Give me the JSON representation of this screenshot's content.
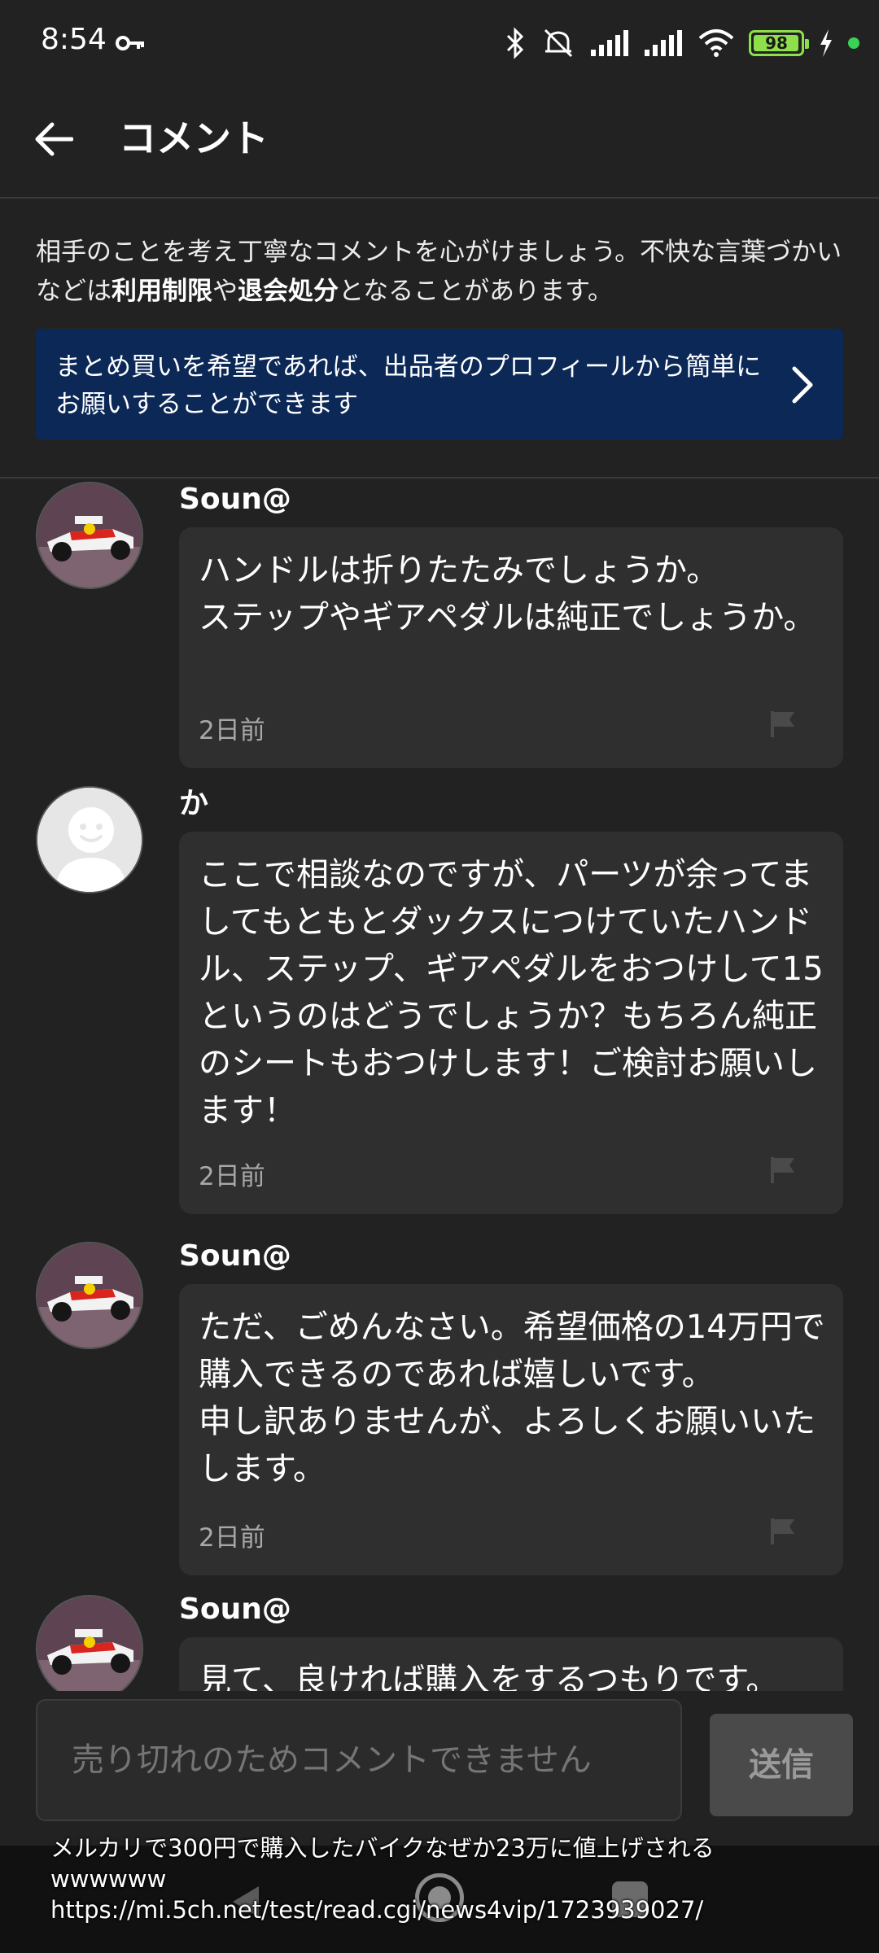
{
  "status_bar": {
    "time": "8:54",
    "battery_level": 98,
    "battery_label": "98",
    "icons": [
      "key-icon",
      "bluetooth-icon",
      "mute-icon",
      "signal-icon",
      "signal-icon",
      "wifi-icon",
      "battery-icon",
      "charging-icon",
      "green-dot"
    ]
  },
  "app_bar": {
    "title": "コメント",
    "back_icon": "arrow-left-icon"
  },
  "guideline": {
    "part1": "相手のことを考え丁寧なコメントを心がけましょう。不快な言葉づかいなどは",
    "bold1": "利用制限",
    "part2": "や",
    "bold2": "退会処分",
    "part3": "となることがあります。"
  },
  "banner": {
    "text": "まとめ買いを希望であれば、出品者のプロフィールから簡単にお願いすることができます",
    "icon": "chevron-right-icon",
    "background": "#0b2857"
  },
  "comments": [
    {
      "author": "Soun@",
      "avatar": "race-car-avatar",
      "text": "ハンドルは折りたたみでしょうか。\nステップやギアペダルは純正でしょうか。",
      "time": "2日前"
    },
    {
      "author": "か",
      "avatar": "default-avatar",
      "text": "ここで相談なのですが、パーツが余ってましてもともとダックスにつけていたハンドル、ステップ、ギアペダルをおつけして15というのはどうでしょうか？もちろん純正のシートもおつけします！ご検討お願いします！",
      "time": "2日前"
    },
    {
      "author": "Soun@",
      "avatar": "race-car-avatar",
      "text": "ただ、ごめんなさい。希望価格の14万円で購入できるのであれば嬉しいです。\n申し訳ありませんが、よろしくお願いいたします。",
      "time": "2日前"
    },
    {
      "author": "Soun@",
      "avatar": "race-car-avatar",
      "text": "見て、良ければ購入をするつもりです。",
      "time": ""
    }
  ],
  "input": {
    "placeholder": "売り切れのためコメントできません",
    "send_label": "送信"
  },
  "caption": {
    "line1": "メルカリで300円で購入したバイクなぜか23万に値上げされる",
    "line2": "wwwwww",
    "line3": "https://mi.5ch.net/test/read.cgi/news4vip/1723939027/"
  },
  "colors": {
    "background": "#222222",
    "bubble": "#2f2f2f",
    "banner": "#0b2857",
    "battery": "#8ee04a"
  }
}
